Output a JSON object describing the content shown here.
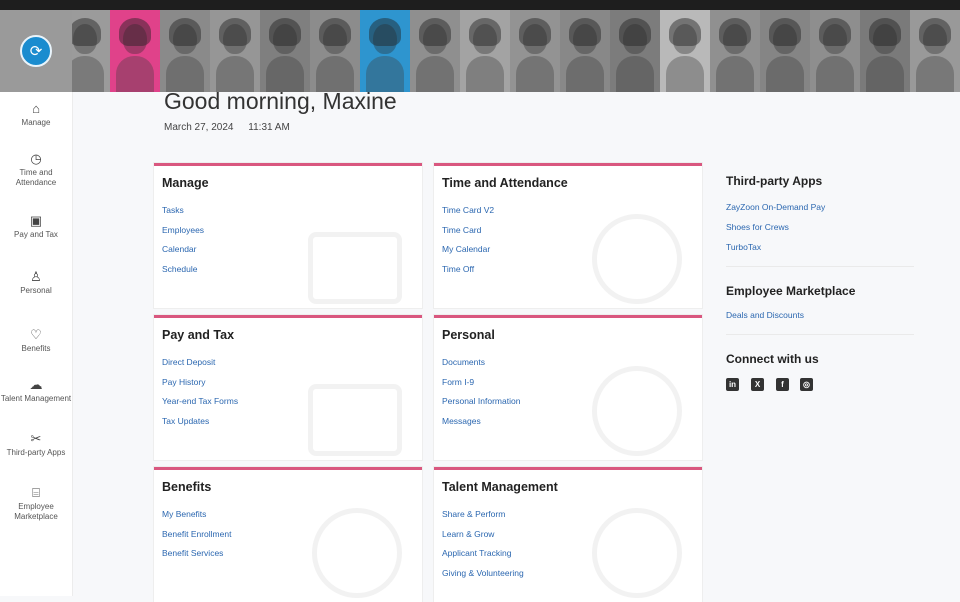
{
  "banner": {
    "alt_label": "Employee photo banner"
  },
  "sidebar": {
    "items": [
      {
        "label": "Manage",
        "icon": "briefcase-icon"
      },
      {
        "label": "Time and Attendance",
        "icon": "clock-icon"
      },
      {
        "label": "Pay and Tax",
        "icon": "money-icon"
      },
      {
        "label": "Personal",
        "icon": "user-icon"
      },
      {
        "label": "Benefits",
        "icon": "heart-icon"
      },
      {
        "label": "Talent Management",
        "icon": "cloud-icon"
      },
      {
        "label": "Third-party Apps",
        "icon": "tools-icon"
      },
      {
        "label": "Employee Marketplace",
        "icon": "gift-icon"
      }
    ]
  },
  "header": {
    "greeting": "Good morning, Maxine",
    "date": "March 27, 2024",
    "time": "11:31 AM"
  },
  "cards": [
    {
      "title": "Manage",
      "links": [
        "Tasks",
        "Employees",
        "Calendar",
        "Schedule"
      ]
    },
    {
      "title": "Time and Attendance",
      "links": [
        "Time Card V2",
        "Time Card",
        "My Calendar",
        "Time Off"
      ]
    },
    {
      "title": "Pay and Tax",
      "links": [
        "Direct Deposit",
        "Pay History",
        "Year-end Tax Forms",
        "Tax Updates"
      ]
    },
    {
      "title": "Personal",
      "links": [
        "Documents",
        "Form I-9",
        "Personal Information",
        "Messages"
      ]
    },
    {
      "title": "Benefits",
      "links": [
        "My Benefits",
        "Benefit Enrollment",
        "Benefit Services"
      ]
    },
    {
      "title": "Talent Management",
      "links": [
        "Share & Perform",
        "Learn & Grow",
        "Applicant Tracking",
        "Giving & Volunteering"
      ]
    }
  ],
  "right": {
    "third_party_title": "Third-party Apps",
    "third_party_links": [
      "ZayZoon On-Demand Pay",
      "Shoes for Crews",
      "TurboTax"
    ],
    "marketplace_title": "Employee Marketplace",
    "marketplace_links": [
      "Deals and Discounts"
    ],
    "connect_title": "Connect with us",
    "social": [
      "linkedin-icon",
      "x-icon",
      "facebook-icon",
      "instagram-icon"
    ]
  },
  "colors": {
    "accent": "#d9577f",
    "link": "#2b67b0",
    "logo": "#1a8ccf"
  }
}
